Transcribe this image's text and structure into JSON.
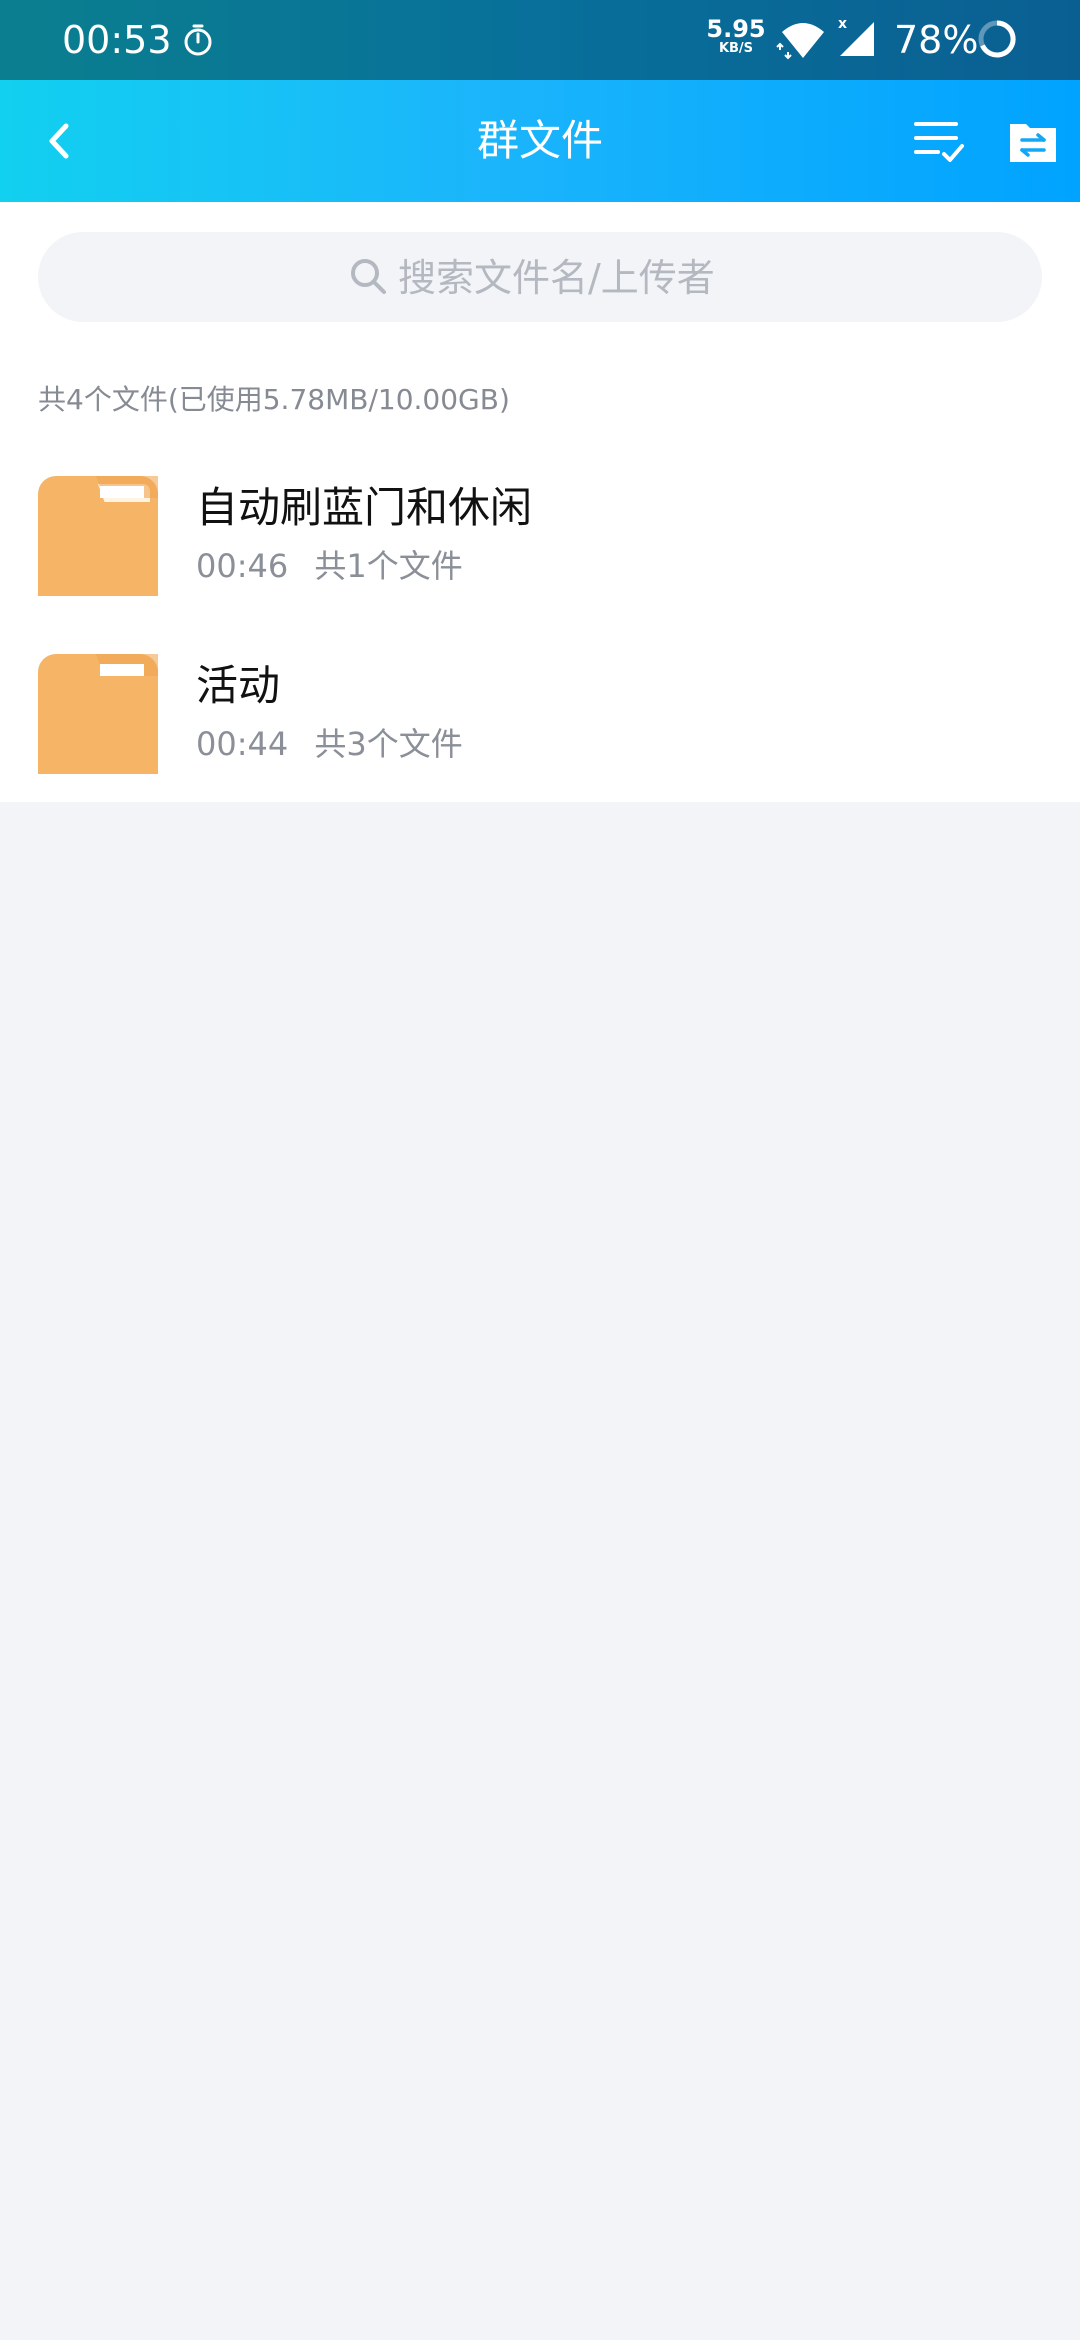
{
  "status_bar": {
    "time": "00:53",
    "net_speed_value": "5.95",
    "net_speed_unit": "KB/S",
    "battery_percent": "78%",
    "icons": [
      "timer-icon",
      "wifi-icon",
      "signal-icon",
      "battery-icon"
    ]
  },
  "header": {
    "title": "群文件",
    "icons": [
      "back-icon",
      "multi-select-icon",
      "file-transfer-icon"
    ]
  },
  "search": {
    "placeholder": "搜索文件名/上传者"
  },
  "summary": {
    "text": "共4个文件(已使用5.78MB/10.00GB)"
  },
  "folders": [
    {
      "name": "自动刷蓝门和休闲",
      "time": "00:46",
      "count": "共1个文件"
    },
    {
      "name": "活动",
      "time": "00:44",
      "count": "共3个文件"
    }
  ],
  "colors": {
    "status_bar": "#0a6f97",
    "header_gradient_start": "#12d0f0",
    "header_gradient_end": "#00a3ff",
    "folder": "#f5b466",
    "background": "#f3f4f8"
  }
}
